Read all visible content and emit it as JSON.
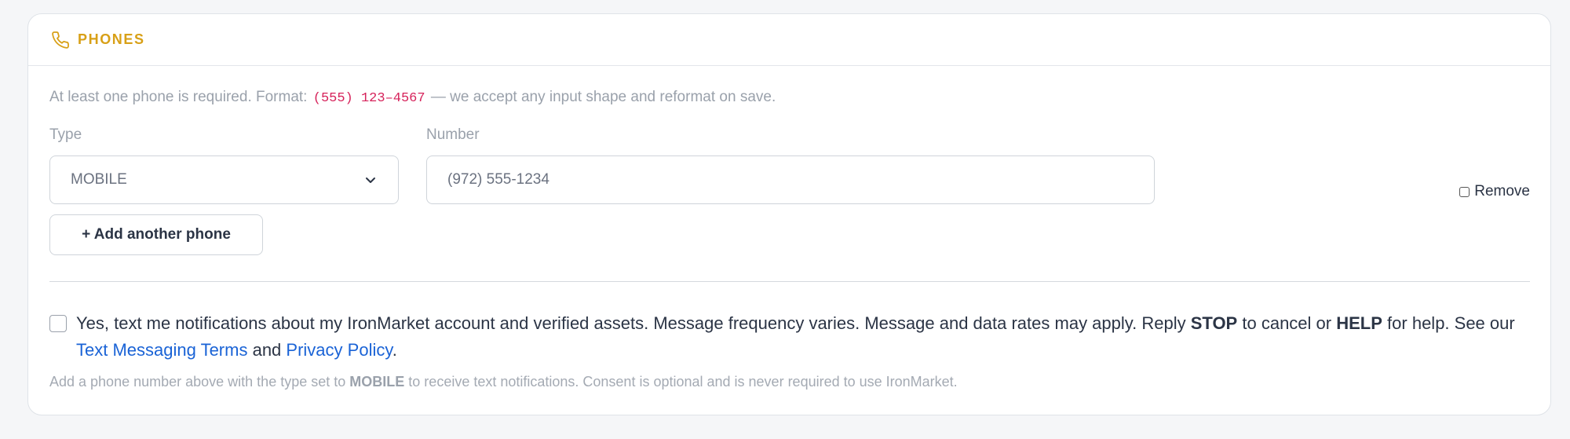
{
  "section": {
    "title": "PHONES",
    "accent_color": "#d8a017",
    "icon": "phone-icon"
  },
  "hint": {
    "prefix": "At least one phone is required. Format:",
    "format_example": "(555) 123–4567",
    "suffix": "— we accept any input shape and reformat on save."
  },
  "phone_entry": {
    "type_label": "Type",
    "type_value": "MOBILE",
    "number_label": "Number",
    "number_value": "(972) 555-1234",
    "remove_label": "Remove",
    "remove_checked": false
  },
  "add_button_label": "+ Add another phone",
  "consent": {
    "checked": false,
    "text_1": "Yes, text me notifications about my IronMarket account and verified assets. Message frequency varies. Message and data rates may apply. Reply",
    "stop_word": "STOP",
    "text_2": "to cancel or",
    "help_word": "HELP",
    "text_3": "for help. See our",
    "terms_link": "Text Messaging Terms",
    "and_word": "and",
    "privacy_link": "Privacy Policy",
    "period": ".",
    "link_color": "#1a63d6"
  },
  "footnote": {
    "prefix": "Add a phone number above with the type set to",
    "emphasis": "MOBILE",
    "suffix": "to receive text notifications. Consent is optional and is never required to use IronMarket."
  }
}
